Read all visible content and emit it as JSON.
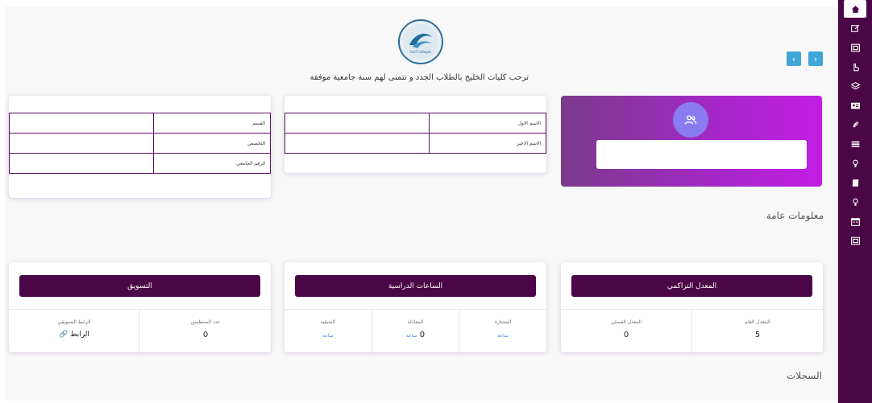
{
  "header": {
    "logo_text": "Gulf Colleges",
    "welcome": "ترحب كليات الخليج بالطلاب الجدد و تتمنى لهم سنة جامعية موفقة",
    "prev_label": "‹",
    "next_label": "›"
  },
  "student_name_table": {
    "first_name_label": "الاسم الاول",
    "first_name_value": "",
    "last_name_label": "الاسم الاخير",
    "last_name_value": ""
  },
  "student_dept_table": {
    "department_label": "القسم",
    "department_value": "",
    "major_label": "التخصص",
    "major_value": "",
    "university_id_label": "الرقم الجامعي",
    "university_id_value": ""
  },
  "profile": {
    "name": ""
  },
  "sections": {
    "general_info": "معلومات عامة",
    "records": "السجلات"
  },
  "gpa_card": {
    "title": "المعدل التراكمي",
    "items": [
      {
        "label": "المعدل العام",
        "value": "5"
      },
      {
        "label": "المعدل الفصلي",
        "value": "0"
      }
    ]
  },
  "hours_card": {
    "title": "الساعات الدراسية",
    "items": [
      {
        "label": "المجتازة",
        "value": "",
        "unit": "ساعة"
      },
      {
        "label": "المعادلة",
        "value": "0",
        "unit": "ساعة"
      },
      {
        "label": "المتبقية",
        "value": "",
        "unit": "ساعة"
      }
    ]
  },
  "marketing_card": {
    "title": "التسويق",
    "items": [
      {
        "label": "عدد المنتظمين",
        "value": "0"
      },
      {
        "label": "الرابط التسويقي",
        "value": "الرابط"
      }
    ]
  },
  "sidebar": {
    "icons": [
      "home-icon",
      "edit-icon",
      "id-card-icon",
      "hand-icon",
      "layers-icon",
      "contact-card-icon",
      "paperclip-icon",
      "list-icon",
      "lightbulb-icon",
      "book-icon",
      "lightbulb-icon",
      "calendar-icon",
      "id-card-icon"
    ]
  },
  "colors": {
    "sidebar": "#4a0646",
    "accent": "#4a0646",
    "link": "#3a7bd5",
    "nav_button": "#3fa7d6"
  }
}
